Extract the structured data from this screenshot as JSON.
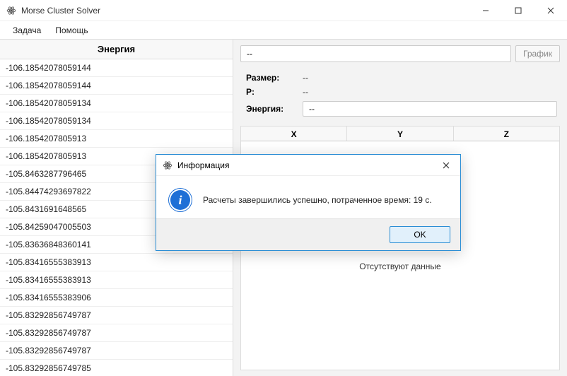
{
  "window": {
    "title": "Morse Cluster Solver"
  },
  "menu": {
    "task": "Задача",
    "help": "Помощь"
  },
  "left": {
    "header": "Энергия",
    "rows": [
      "-106.18542078059144",
      "-106.18542078059144",
      "-106.18542078059134",
      "-106.18542078059134",
      "-106.1854207805913",
      "-106.1854207805913",
      "-105.8463287796465",
      "-105.84474293697822",
      "-105.8431691648565",
      "-105.84259047005503",
      "-105.83636848360141",
      "-105.83416555383913",
      "-105.83416555383913",
      "-105.83416555383906",
      "-105.83292856749787",
      "-105.83292856749787",
      "-105.83292856749787",
      "-105.83292856749785"
    ]
  },
  "right": {
    "input_value": "--",
    "chart_button": "График",
    "size_label": "Размер:",
    "size_value": "--",
    "p_label": "P:",
    "p_value": "--",
    "energy_label": "Энергия:",
    "energy_value": "--",
    "col_x": "X",
    "col_y": "Y",
    "col_z": "Z",
    "no_data": "Отсутствуют данные"
  },
  "dialog": {
    "title": "Информация",
    "message": "Расчеты завершились успешно, потраченное время: 19 с.",
    "ok": "OK"
  }
}
